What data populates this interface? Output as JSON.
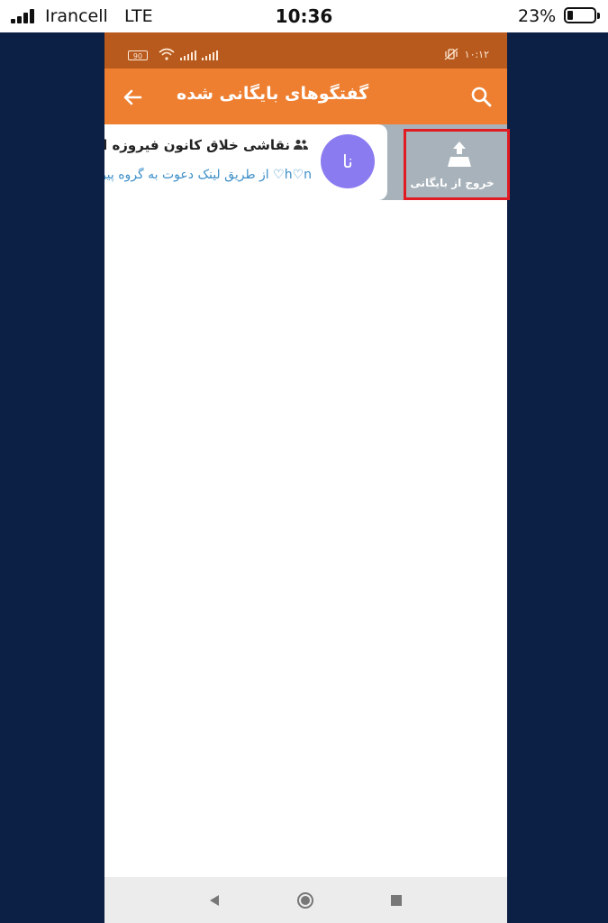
{
  "ios_status": {
    "carrier": "Irancell",
    "network": "LTE",
    "time": "10:36",
    "battery_percent": "23%"
  },
  "android_status": {
    "battery": "90",
    "time": "۱۰:۱۲"
  },
  "toolbar": {
    "title": "گفتگوهای بایگانی شده",
    "back_icon": "arrow-left-icon",
    "search_icon": "search-icon"
  },
  "chat": {
    "avatar_initials": "نا",
    "name": "نقاشی خلاق کانون فیروزه ایران",
    "preview": "h♡n♡ از طریق لینک دعوت به گروه پیوست",
    "avatar_color": "#8a7cf0",
    "preview_color": "#3d8fc8"
  },
  "swipe_action": {
    "label": "خروج از بایگانی",
    "icon": "unarchive-icon",
    "highlight_color": "#e11b24"
  },
  "colors": {
    "toolbar": "#ee7f31",
    "status_bar": "#b85a1d",
    "swipe_bg": "#a7b2ba",
    "background": "#0c1f45"
  }
}
